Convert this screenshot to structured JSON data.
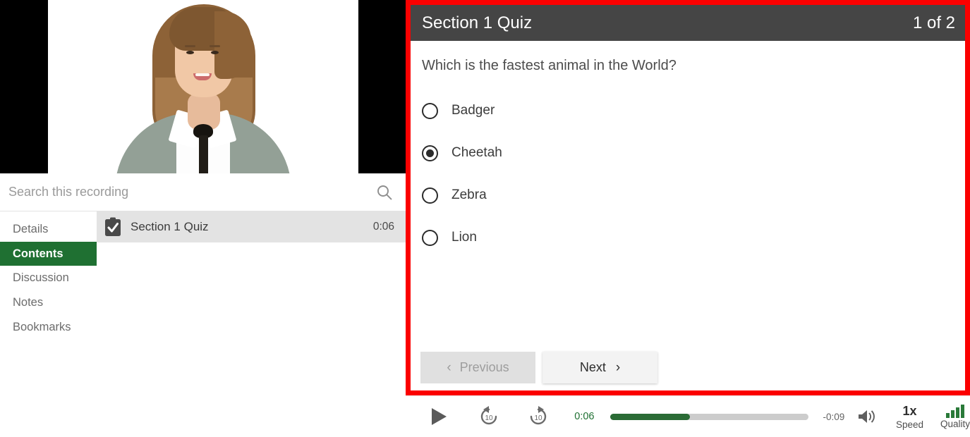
{
  "video": {
    "name": "presenter-video",
    "letterbox_color": "#000000"
  },
  "search": {
    "placeholder": "Search this recording",
    "value": "",
    "icon": "search-icon"
  },
  "sidebar": {
    "tabs": [
      {
        "label": "Details",
        "active": false
      },
      {
        "label": "Contents",
        "active": true
      },
      {
        "label": "Discussion",
        "active": false
      },
      {
        "label": "Notes",
        "active": false
      },
      {
        "label": "Bookmarks",
        "active": false
      }
    ],
    "active_color": "#1f7032",
    "contents": [
      {
        "icon": "quiz-clipboard-icon",
        "title": "Section 1 Quiz",
        "time": "0:06"
      }
    ]
  },
  "quiz": {
    "highlight_color": "#fb0000",
    "header": {
      "title": "Section 1 Quiz",
      "counter": "1 of 2",
      "background": "#454545"
    },
    "question": "Which is the fastest animal in the World?",
    "options": [
      {
        "label": "Badger",
        "selected": false
      },
      {
        "label": "Cheetah",
        "selected": true
      },
      {
        "label": "Zebra",
        "selected": false
      },
      {
        "label": "Lion",
        "selected": false
      }
    ],
    "nav": {
      "previous_label": "Previous",
      "previous_disabled": true,
      "next_label": "Next",
      "prev_chevron": "‹",
      "next_chevron": "›"
    }
  },
  "player": {
    "play_icon": "play-icon",
    "rewind_label": "10",
    "forward_label": "10",
    "current_time": "0:06",
    "remaining_time": "-0:09",
    "progress_percent": 40,
    "progress_color": "#2a6b35",
    "volume_icon": "volume-icon",
    "speed_value": "1x",
    "speed_label": "Speed",
    "quality_label": "Quality",
    "quality_bars": 4,
    "quality_color": "#2a7a39"
  }
}
